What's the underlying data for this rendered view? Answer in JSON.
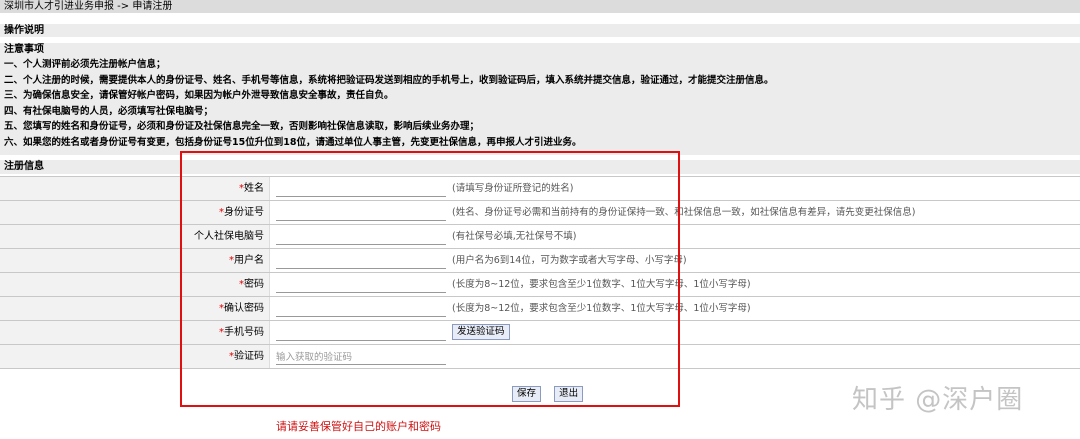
{
  "breadcrumb": "深圳市人才引进业务申报 -> 申请注册",
  "sections": {
    "operation": "操作说明",
    "notes_title": "注意事项",
    "register": "注册信息"
  },
  "notes": [
    "一、个人测评前必须先注册帐户信息；",
    "二、个人注册的时候，需要提供本人的身份证号、姓名、手机号等信息，系统将把验证码发送到相应的手机号上，收到验证码后，填入系统并提交信息，验证通过，才能提交注册信息。",
    "三、为确保信息安全，请保管好帐户密码，如果因为帐户外泄导致信息安全事故，责任自负。",
    "四、有社保电脑号的人员，必须填写社保电脑号；",
    "五、您填写的姓名和身份证号，必须和身份证及社保信息完全一致，否则影响社保信息读取，影响后续业务办理；",
    "六、如果您的姓名或者身份证号有变更，包括身份证号15位升位到18位，请通过单位人事主管，先变更社保信息，再申报人才引进业务。"
  ],
  "form": {
    "name": {
      "label": "姓名",
      "hint": "(请填写身份证所登记的姓名)"
    },
    "id_number": {
      "label": "身份证号",
      "hint": "(姓名、身份证号必需和当前持有的身份证保持一致、和社保信息一致，如社保信息有差异，请先变更社保信息)"
    },
    "social_security": {
      "label": "个人社保电脑号",
      "hint": "(有社保号必填,无社保号不填)"
    },
    "username": {
      "label": "用户名",
      "hint": "(用户名为6到14位，可为数字或者大写字母、小写字母)"
    },
    "password": {
      "label": "密码",
      "hint": "(长度为8~12位，要求包含至少1位数字、1位大写字母、1位小写字母)"
    },
    "confirm_password": {
      "label": "确认密码",
      "hint": "(长度为8~12位，要求包含至少1位数字、1位大写字母、1位小写字母)"
    },
    "phone": {
      "label": "手机号码",
      "button": "发送验证码"
    },
    "code": {
      "label": "验证码",
      "placeholder": "输入获取的验证码"
    }
  },
  "required_mark": "*",
  "actions": {
    "save": "保存",
    "exit": "退出"
  },
  "warning": "请请妥善保管好自己的账户和密码",
  "watermark": "知乎 @深户圈",
  "colors": {
    "highlight_box": "#e01010",
    "required": "#e00000",
    "warning_text": "#d01010"
  }
}
